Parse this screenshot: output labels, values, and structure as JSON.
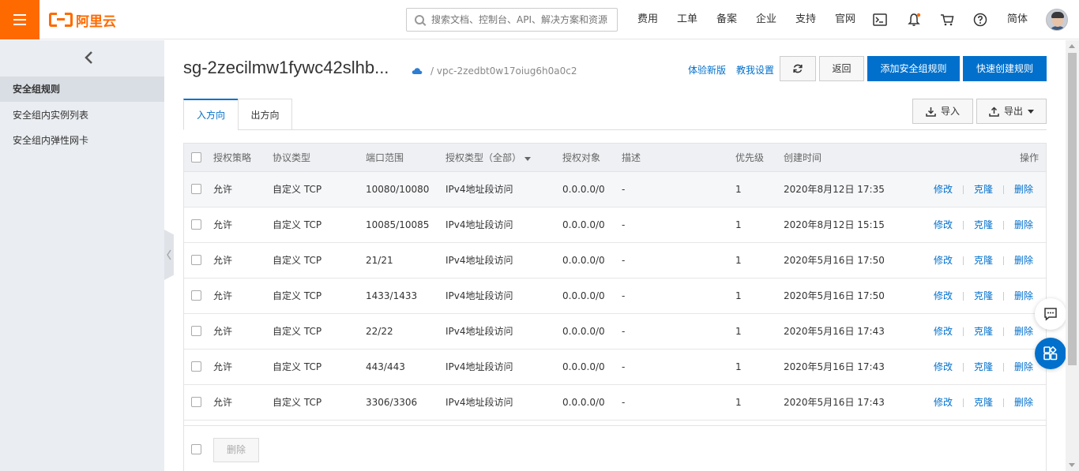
{
  "brand": {
    "name": "阿里云",
    "color": "#ff6a00"
  },
  "search": {
    "placeholder": "搜索文档、控制台、API、解决方案和资源"
  },
  "topnav": [
    "费用",
    "工单",
    "备案",
    "企业",
    "支持",
    "官网"
  ],
  "topnav_right": {
    "lang": "简体"
  },
  "icons": {
    "terminal": "terminal-icon",
    "bell": "bell-icon",
    "cart": "cart-icon",
    "help": "help-icon"
  },
  "sidebar": {
    "items": [
      {
        "label": "安全组规则",
        "active": true
      },
      {
        "label": "安全组内实例列表",
        "active": false
      },
      {
        "label": "安全组内弹性网卡",
        "active": false
      }
    ]
  },
  "header": {
    "title": "sg-2zecilmw1fywc42slhb...",
    "vpc": "/ vpc-2zedbt0w17oiug6h0a0c2",
    "try_new": "体验新版",
    "teach": "教我设置",
    "back": "返回",
    "add_rule": "添加安全组规则",
    "quick_rule": "快速创建规则"
  },
  "tabs": [
    "入方向",
    "出方向"
  ],
  "tools": {
    "import": "导入",
    "export": "导出"
  },
  "table": {
    "headers": [
      "授权策略",
      "协议类型",
      "端口范围",
      "授权类型（全部）",
      "授权对象",
      "描述",
      "优先级",
      "创建时间",
      "操作"
    ],
    "rows": [
      {
        "policy": "允许",
        "protocol": "自定义 TCP",
        "port": "10080/10080",
        "auth_type": "IPv4地址段访问",
        "object": "0.0.0.0/0",
        "desc": "-",
        "priority": "1",
        "created": "2020年8月12日 17:35"
      },
      {
        "policy": "允许",
        "protocol": "自定义 TCP",
        "port": "10085/10085",
        "auth_type": "IPv4地址段访问",
        "object": "0.0.0.0/0",
        "desc": "-",
        "priority": "1",
        "created": "2020年8月12日 15:15"
      },
      {
        "policy": "允许",
        "protocol": "自定义 TCP",
        "port": "21/21",
        "auth_type": "IPv4地址段访问",
        "object": "0.0.0.0/0",
        "desc": "-",
        "priority": "1",
        "created": "2020年5月16日 17:50"
      },
      {
        "policy": "允许",
        "protocol": "自定义 TCP",
        "port": "1433/1433",
        "auth_type": "IPv4地址段访问",
        "object": "0.0.0.0/0",
        "desc": "-",
        "priority": "1",
        "created": "2020年5月16日 17:50"
      },
      {
        "policy": "允许",
        "protocol": "自定义 TCP",
        "port": "22/22",
        "auth_type": "IPv4地址段访问",
        "object": "0.0.0.0/0",
        "desc": "-",
        "priority": "1",
        "created": "2020年5月16日 17:43"
      },
      {
        "policy": "允许",
        "protocol": "自定义 TCP",
        "port": "443/443",
        "auth_type": "IPv4地址段访问",
        "object": "0.0.0.0/0",
        "desc": "-",
        "priority": "1",
        "created": "2020年5月16日 17:43"
      },
      {
        "policy": "允许",
        "protocol": "自定义 TCP",
        "port": "3306/3306",
        "auth_type": "IPv4地址段访问",
        "object": "0.0.0.0/0",
        "desc": "-",
        "priority": "1",
        "created": "2020年5月16日 17:43"
      }
    ],
    "actions": {
      "edit": "修改",
      "clone": "克隆",
      "delete": "删除"
    }
  },
  "footer": {
    "delete": "删除"
  },
  "colors": {
    "link": "#0070cc",
    "sidebar_bg": "#eaedf1",
    "header_bg": "#eef0f3"
  }
}
